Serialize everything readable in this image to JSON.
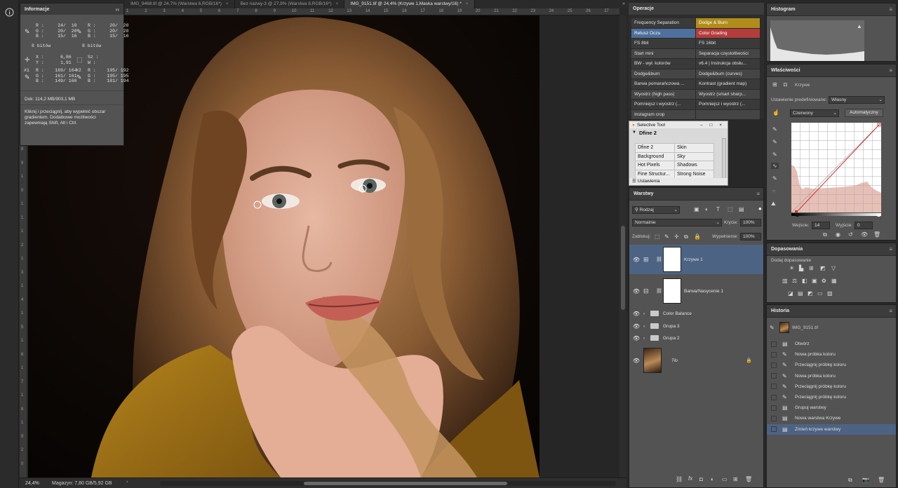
{
  "tabs": [
    {
      "label": "IMG_9468.tif @ 24,7% (Warstwa 6,RGB/16*)",
      "active": false
    },
    {
      "label": "Bez nazwy-3 @ 27,9% (Warstwa 8,RGB/16*)",
      "active": false
    },
    {
      "label": "IMG_9151.tif @ 24,4% (Krzywe 1,Maska warstwy/16) *",
      "active": true
    }
  ],
  "tab_close": "×",
  "tab_overflow": "»",
  "info": {
    "title": "Informacje",
    "collapse": "‹‹",
    "rgb1": "R :     24/  10\nG :     20/  20\nB :     15/  16",
    "rgb2": "R :     20/  20\nG :     20/  20\nB :     15/  16",
    "bits1": "8 bitów",
    "bits2": "8 bitów",
    "xy": "X :      6,86\nY :      1,91",
    "wh": "Sz :\nW :",
    "s1": "R :    169/ 164\nG :    161/ 161\nB :    149/ 160",
    "s2": "R :    195/ 192\nG :    195/ 195\nB :    181/ 194",
    "s1_label": "#1",
    "s2_label": "#2",
    "doc": "Dok: 114,2 MB/903,1 MB",
    "hint": "Kliknij i przeciągnij, aby wypełnić obszar gradientem. Dodatkowe możliwości zapewniają Shift, Alt i Ctrl."
  },
  "ruler_marks": [
    "1",
    "2",
    "3",
    "4",
    "5",
    "6",
    "7",
    "8",
    "9",
    "10",
    "11",
    "12",
    "13",
    "14",
    "15",
    "16",
    "17",
    "18",
    "19",
    "20",
    "21",
    "22",
    "23",
    "24",
    "25",
    "26",
    "27"
  ],
  "vruler_marks": [
    "8",
    "9",
    "1",
    "0",
    "1",
    "1",
    "1",
    "2",
    "1",
    "3",
    "1",
    "4",
    "1",
    "5",
    "1",
    "6",
    "1",
    "7",
    "1",
    "8",
    "1",
    "9",
    "2",
    "0"
  ],
  "status": {
    "zoom": "24,4%",
    "memory": "Magazyn: 7,80 GB/5,92 GB",
    "arrow": "›"
  },
  "operations": {
    "title": "Operacje",
    "items": [
      {
        "label": "Frequency Separation",
        "color": "#3a3a3a",
        "text": "#e0e0e0"
      },
      {
        "label": "Dodge & Burn",
        "color": "#b08d1b",
        "text": "#ffffff"
      },
      {
        "label": "Retusz Oczu",
        "color": "#4f6f9c",
        "text": "#ffffff"
      },
      {
        "label": "Color Grading",
        "color": "#b53c3c",
        "text": "#ffffff"
      },
      {
        "label": "FS 8bit",
        "color": "#3a3a3a",
        "text": "#e0e0e0"
      },
      {
        "label": "FS 16bit",
        "color": "#3a3a3a",
        "text": "#e0e0e0"
      },
      {
        "label": "Start mini",
        "color": "#454545",
        "text": "#e0e0e0"
      },
      {
        "label": "Separacja częstotliwości",
        "color": "#454545",
        "text": "#e0e0e0"
      },
      {
        "label": "BW - wył. kolorów",
        "color": "#3a3a3a",
        "text": "#e0e0e0"
      },
      {
        "label": "v6.4 | Instrukcja obsłu...",
        "color": "#3a3a3a",
        "text": "#e0e0e0"
      },
      {
        "label": "Dodge&burn",
        "color": "#454545",
        "text": "#e0e0e0"
      },
      {
        "label": "Dodge&burn (curves)",
        "color": "#454545",
        "text": "#e0e0e0"
      },
      {
        "label": "Barwa pomarańczowa ...",
        "color": "#3a3a3a",
        "text": "#e0e0e0"
      },
      {
        "label": "Kontrast (gradient map)",
        "color": "#3a3a3a",
        "text": "#e0e0e0"
      },
      {
        "label": "Wyostrz (high pass)",
        "color": "#454545",
        "text": "#e0e0e0"
      },
      {
        "label": "Wyostrz (smart sharp...",
        "color": "#454545",
        "text": "#e0e0e0"
      },
      {
        "label": "Pomniejsz i wyostrz (...",
        "color": "#3a3a3a",
        "text": "#e0e0e0"
      },
      {
        "label": "Pomniejsz i wyostrz (...",
        "color": "#3a3a3a",
        "text": "#e0e0e0"
      },
      {
        "label": "Instagram crop",
        "color": "#454545",
        "text": "#e0e0e0"
      },
      {
        "label": "",
        "color": "#454545",
        "text": "#e0e0e0"
      }
    ]
  },
  "selective_tool": {
    "window_title": "Selective Tool",
    "title": "Dfine 2",
    "cells": [
      [
        "Dfine 2",
        "Skin"
      ],
      [
        "Background",
        "Sky"
      ],
      [
        "Hot Pixels",
        "Shadows"
      ],
      [
        "Fine Structur...",
        "Strong Noise"
      ]
    ],
    "footer": "Ustawienia",
    "win_controls": "– □ ×"
  },
  "layers": {
    "title": "Warstwy",
    "filter_kind": "Rodzaj",
    "blend_mode": "Normalnie",
    "opacity_label": "Krycie:",
    "opacity": "100%",
    "lock_label": "Zablokuj:",
    "fill_label": "Wypełnienie:",
    "fill": "100%",
    "rows": [
      {
        "name": "Krzywe 1",
        "type": "adjustment",
        "selected": true
      },
      {
        "name": "Barwa/Nasycenie 1",
        "type": "adjustment",
        "selected": false
      },
      {
        "name": "Color Balance",
        "type": "group",
        "selected": false
      },
      {
        "name": "Grupa 3",
        "type": "group",
        "selected": false
      },
      {
        "name": "Grupa 2",
        "type": "group",
        "selected": false
      },
      {
        "name": "Tło",
        "type": "background",
        "selected": false
      }
    ]
  },
  "histogram": {
    "title": "Histogram",
    "warning": "▲"
  },
  "properties": {
    "title": "Właściwości",
    "subtitle": "Krzywe",
    "preset_label": "Ustawienie predefiniowane:",
    "preset": "Własny",
    "channel": "Czerwony",
    "auto_label": "Automatyczny",
    "input_label": "Wejście:",
    "input": "14",
    "output_label": "Wyjście:",
    "output": "0"
  },
  "adjustments": {
    "title": "Dopasowania",
    "add_label": "Dodaj dopasowanie"
  },
  "history": {
    "title": "Historia",
    "snapshot": "IMG_9151.tif",
    "items": [
      {
        "label": "Otwórz",
        "selected": false
      },
      {
        "label": "Nowa próbka koloru",
        "selected": false
      },
      {
        "label": "Przeciągnij próbkę koloru",
        "selected": false
      },
      {
        "label": "Nowa próbka koloru",
        "selected": false
      },
      {
        "label": "Przeciągnij próbkę koloru",
        "selected": false
      },
      {
        "label": "Przeciągnij próbkę koloru",
        "selected": false
      },
      {
        "label": "Grupuj warstwy",
        "selected": false
      },
      {
        "label": "Nowa warstwa Krzywe",
        "selected": false
      },
      {
        "label": "Zmień krzywe warstwy",
        "selected": true
      }
    ]
  }
}
